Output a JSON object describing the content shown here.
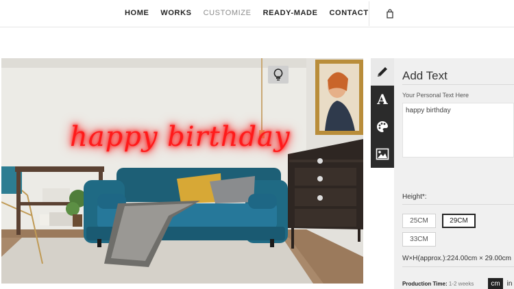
{
  "nav": {
    "items": [
      "HOME",
      "WORKS",
      "CUSTOMIZE",
      "READY-MADE",
      "CONTACT"
    ],
    "active": "CUSTOMIZE"
  },
  "icons": {
    "cart": "shopping-bag-icon",
    "bulb": "lightbulb-icon",
    "tools": [
      "pencil-icon",
      "font-icon",
      "palette-icon",
      "image-icon"
    ]
  },
  "preview": {
    "neon_text": "happy birthday",
    "neon_color": "#ff1a1a"
  },
  "panel": {
    "title": "Add Text",
    "text_label": "Your Personal Text Here",
    "text_value": "happy birthday",
    "height_label": "Height*:",
    "sizes": [
      "25CM",
      "29CM",
      "33CM"
    ],
    "selected_size": "29CM",
    "dimensions": "W×H(approx.):224.00cm × 29.00cm",
    "production_label": "Production Time:",
    "production_value": "1-2 weeks",
    "unit_cm": "cm",
    "unit_in": "in",
    "selected_unit": "cm"
  }
}
